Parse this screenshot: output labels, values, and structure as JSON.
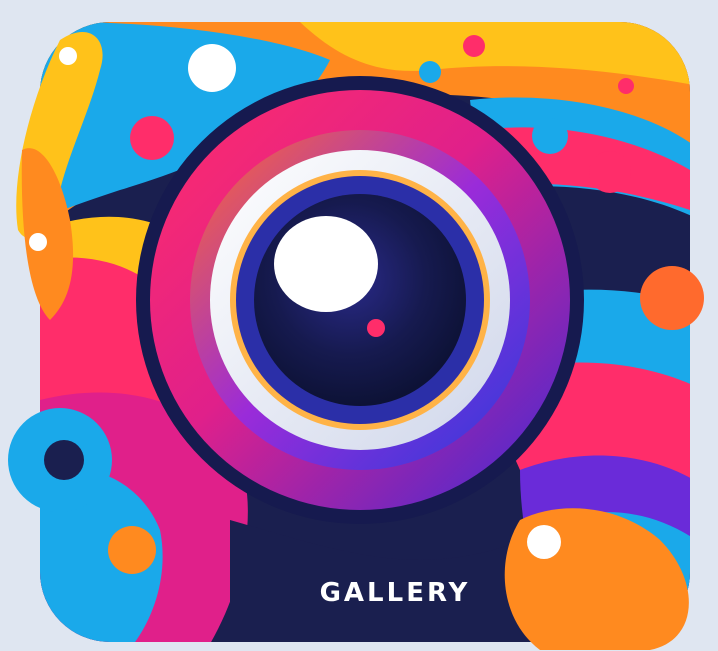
{
  "icon": {
    "label": "GALLERY",
    "depicts": "camera-lens-icon"
  },
  "palette": {
    "background": "#dfe6f1",
    "navy": "#1a1f4f",
    "cyan": "#1aa9ea",
    "orange": "#ff8a1f",
    "yellow": "#ffc21a",
    "pink": "#ff2d6a",
    "magenta": "#e0208a",
    "purple": "#6a2bd9",
    "white": "#ffffff"
  }
}
